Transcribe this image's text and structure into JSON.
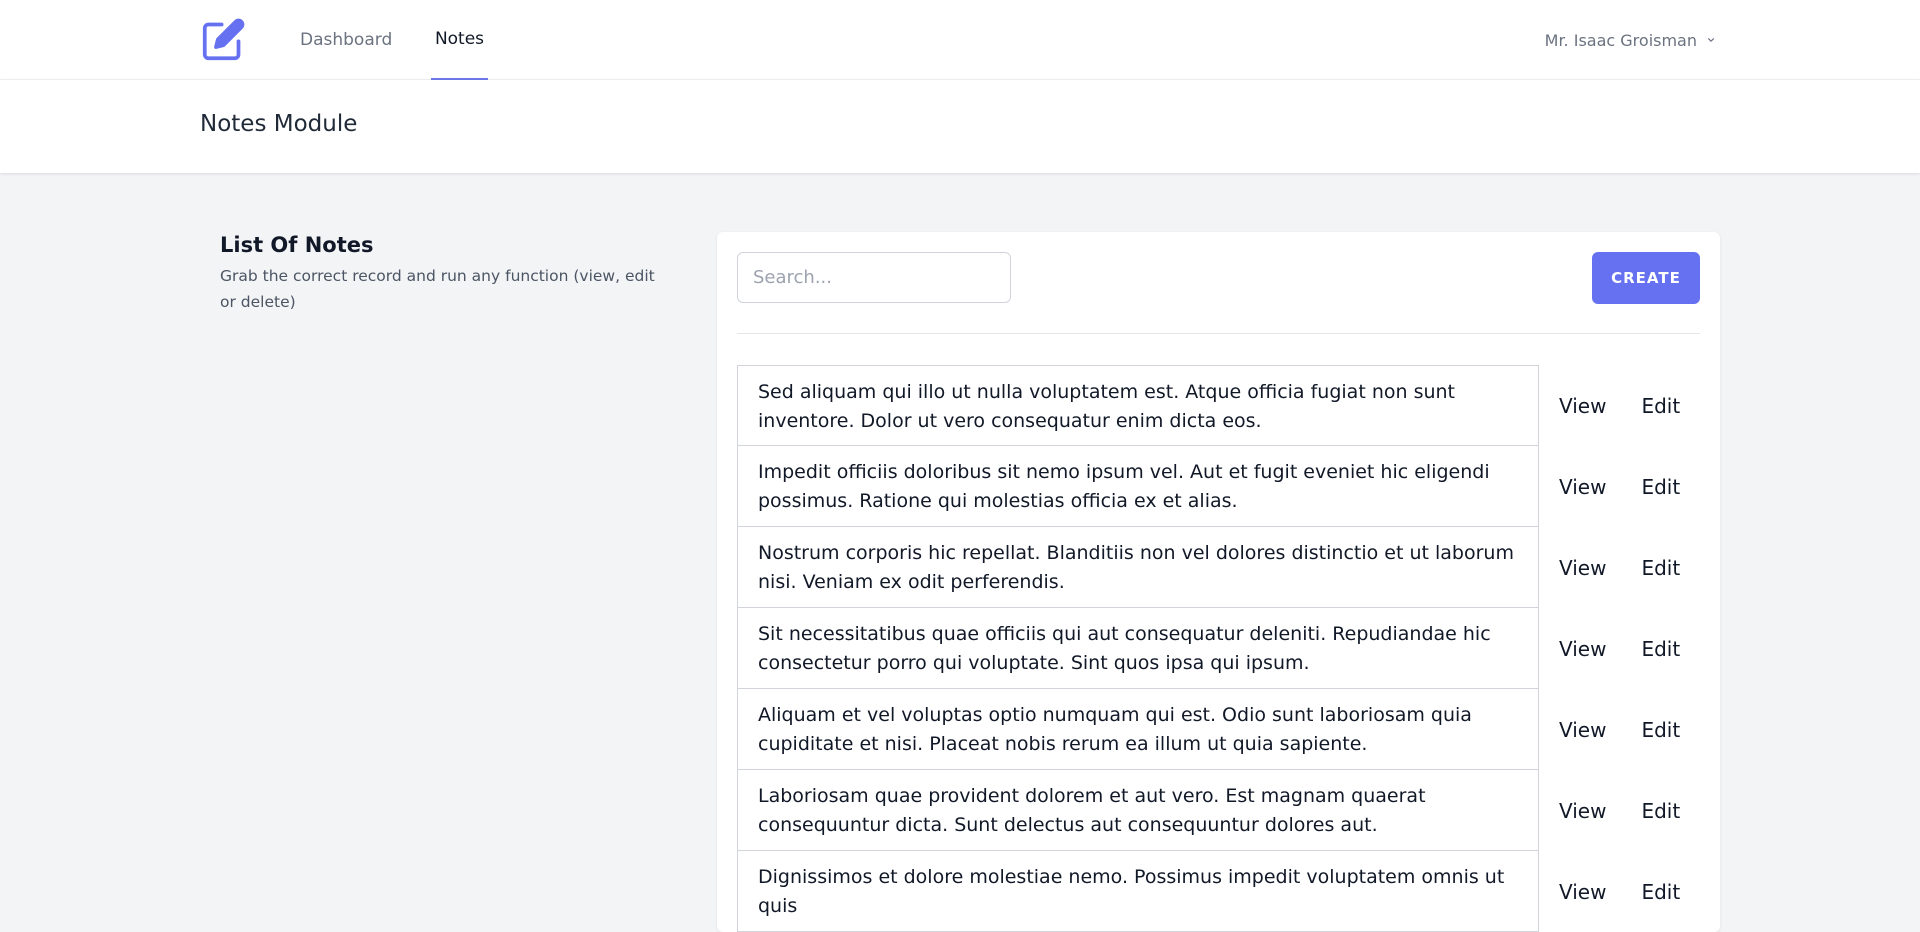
{
  "nav": {
    "logo_icon": "note-edit-icon",
    "links": [
      "Dashboard",
      "Notes"
    ],
    "active": "Notes",
    "user_name": "Mr. Isaac Groisman",
    "accent": "#6571f1"
  },
  "header": {
    "title": "Notes Module"
  },
  "section": {
    "title": "List Of Notes",
    "description": "Grab the correct record and run any function (view, edit or delete)"
  },
  "toolbar": {
    "search_placeholder": "Search...",
    "create_label": "CREATE"
  },
  "notes": [
    "Sed aliquam qui illo ut nulla voluptatem est. Atque officia fugiat non sunt inventore. Dolor ut vero consequatur enim dicta eos.",
    "Impedit officiis doloribus sit nemo ipsum vel. Aut et fugit eveniet hic eligendi possimus. Ratione qui molestias officia ex et alias.",
    "Nostrum corporis hic repellat. Blanditiis non vel dolores distinctio et ut laborum nisi. Veniam ex odit perferendis.",
    "Sit necessitatibus quae officiis qui aut consequatur deleniti. Repudiandae hic consectetur porro qui voluptate. Sint quos ipsa qui ipsum.",
    "Aliquam et vel voluptas optio numquam qui est. Odio sunt laboriosam quia cupiditate et nisi. Placeat nobis rerum ea illum ut quia sapiente.",
    "Laboriosam quae provident dolorem et aut vero. Est magnam quaerat consequuntur dicta. Sunt delectus aut consequuntur dolores aut.",
    "Dignissimos et dolore molestiae nemo. Possimus impedit voluptatem omnis ut quis"
  ],
  "row_actions": {
    "view": "View",
    "edit": "Edit"
  }
}
